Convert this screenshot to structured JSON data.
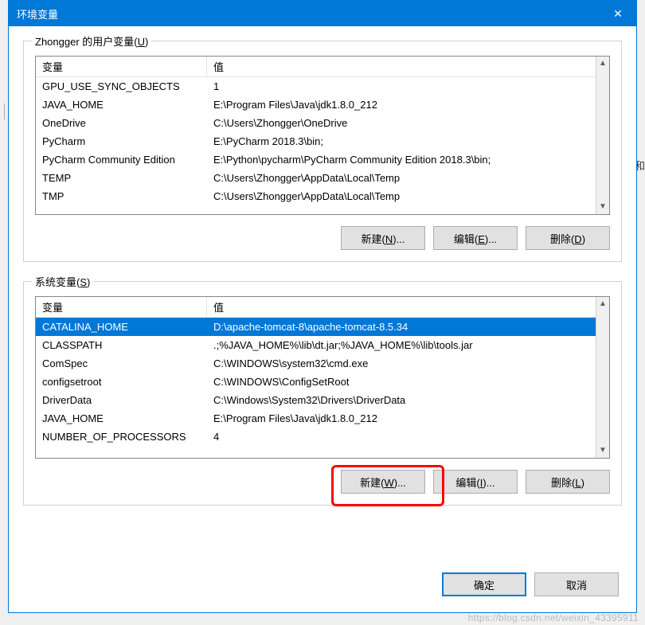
{
  "dialog": {
    "title": "环境变量",
    "close_icon": "✕"
  },
  "user_section": {
    "label_pre": "Zhongger 的用户变量(",
    "label_u": "U",
    "label_post": ")",
    "header_var": "变量",
    "header_val": "值",
    "rows": [
      {
        "name": "GPU_USE_SYNC_OBJECTS",
        "value": "1"
      },
      {
        "name": "JAVA_HOME",
        "value": "E:\\Program Files\\Java\\jdk1.8.0_212"
      },
      {
        "name": "OneDrive",
        "value": "C:\\Users\\Zhongger\\OneDrive"
      },
      {
        "name": "PyCharm",
        "value": "E:\\PyCharm 2018.3\\bin;"
      },
      {
        "name": "PyCharm Community Edition",
        "value": "E:\\Python\\pycharm\\PyCharm Community Edition 2018.3\\bin;"
      },
      {
        "name": "TEMP",
        "value": "C:\\Users\\Zhongger\\AppData\\Local\\Temp"
      },
      {
        "name": "TMP",
        "value": "C:\\Users\\Zhongger\\AppData\\Local\\Temp"
      }
    ],
    "btn_new_pre": "新建(",
    "btn_new_u": "N",
    "btn_new_post": ")...",
    "btn_edit_pre": "编辑(",
    "btn_edit_u": "E",
    "btn_edit_post": ")...",
    "btn_del_pre": "删除(",
    "btn_del_u": "D",
    "btn_del_post": ")"
  },
  "system_section": {
    "label_pre": "系统变量(",
    "label_u": "S",
    "label_post": ")",
    "header_var": "变量",
    "header_val": "值",
    "selected_index": 0,
    "rows": [
      {
        "name": "CATALINA_HOME",
        "value": "D:\\apache-tomcat-8\\apache-tomcat-8.5.34"
      },
      {
        "name": "CLASSPATH",
        "value": ".;%JAVA_HOME%\\lib\\dt.jar;%JAVA_HOME%\\lib\\tools.jar"
      },
      {
        "name": "ComSpec",
        "value": "C:\\WINDOWS\\system32\\cmd.exe"
      },
      {
        "name": "configsetroot",
        "value": "C:\\WINDOWS\\ConfigSetRoot"
      },
      {
        "name": "DriverData",
        "value": "C:\\Windows\\System32\\Drivers\\DriverData"
      },
      {
        "name": "JAVA_HOME",
        "value": "E:\\Program Files\\Java\\jdk1.8.0_212"
      },
      {
        "name": "NUMBER_OF_PROCESSORS",
        "value": "4"
      }
    ],
    "btn_new_pre": "新建(",
    "btn_new_u": "W",
    "btn_new_post": ")...",
    "btn_edit_pre": "编辑(",
    "btn_edit_u": "I",
    "btn_edit_post": ")...",
    "btn_del_pre": "删除(",
    "btn_del_u": "L",
    "btn_del_post": ")"
  },
  "footer": {
    "ok": "确定",
    "cancel": "取消"
  },
  "watermark": "https://blog.csdn.net/weixin_43395911",
  "side_char": "和"
}
